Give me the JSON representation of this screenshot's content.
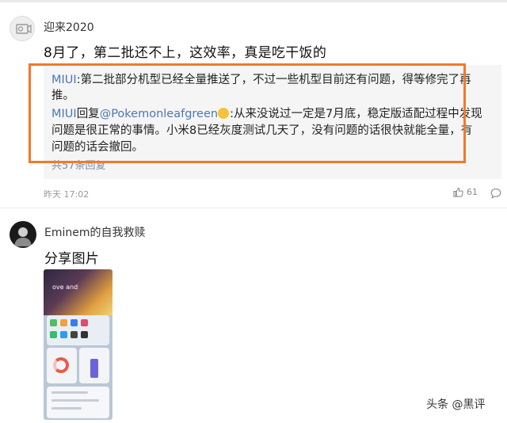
{
  "comments": [
    {
      "username": "迎来2020",
      "text": "8月了，第二批还不上，这效率，真是吃干饭的",
      "replies": {
        "line1_author": "MIUI",
        "line1_text": ":第二批部分机型已经全量推送了，不过一些机型目前还有问题，得等修完了再",
        "line2_text": "推。",
        "line3_author": "MIUI",
        "line3_mid": "回复",
        "line3_mention": "@Pokemonleafgreen",
        "line3_text": ":从来没说过一定是7月底，稳定版适配过程中发现",
        "line4_text": "问题是很正常的事情。小米8已经灰度测试几天了，没有问题的话很快就能全量，有",
        "line5_text": "问题的话会撤回。",
        "more_replies": "共57条回复"
      },
      "timestamp": "昨天 17:02",
      "likes": "61"
    },
    {
      "username": "Eminem的自我救赎",
      "text": "分享图片",
      "shared_image_text": "ove and"
    }
  ],
  "watermark": "头条 @黑评",
  "highlight_color": "#f07a2a"
}
